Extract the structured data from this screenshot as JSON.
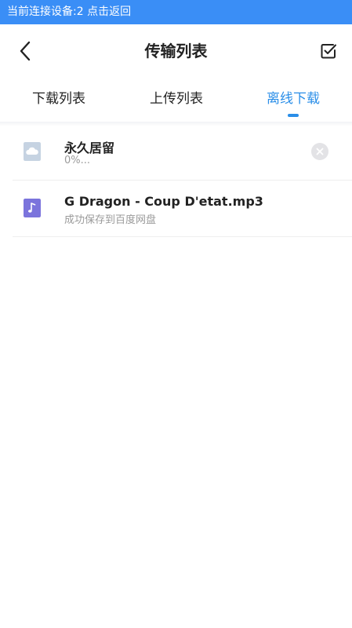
{
  "status_banner": {
    "text": "当前连接设备:2 点击返回",
    "bg_color": "#3a8ef6"
  },
  "header": {
    "title": "传输列表",
    "back_icon": "chevron-left-icon",
    "edit_icon": "checkbox-edit-icon"
  },
  "tabs": [
    {
      "label": "下载列表",
      "active": false
    },
    {
      "label": "上传列表",
      "active": false
    },
    {
      "label": "离线下载",
      "active": true
    }
  ],
  "accent_color": "#2a8ee8",
  "items": [
    {
      "title": "永久居留",
      "subtitle": "0%...",
      "icon": "cloud-file-icon",
      "icon_color": "#c6d3e2",
      "has_cancel": true
    },
    {
      "title": "G Dragon - Coup D'etat.mp3",
      "subtitle": "成功保存到百度网盘",
      "icon": "music-file-icon",
      "icon_color": "#7b74dc",
      "has_cancel": false
    }
  ]
}
